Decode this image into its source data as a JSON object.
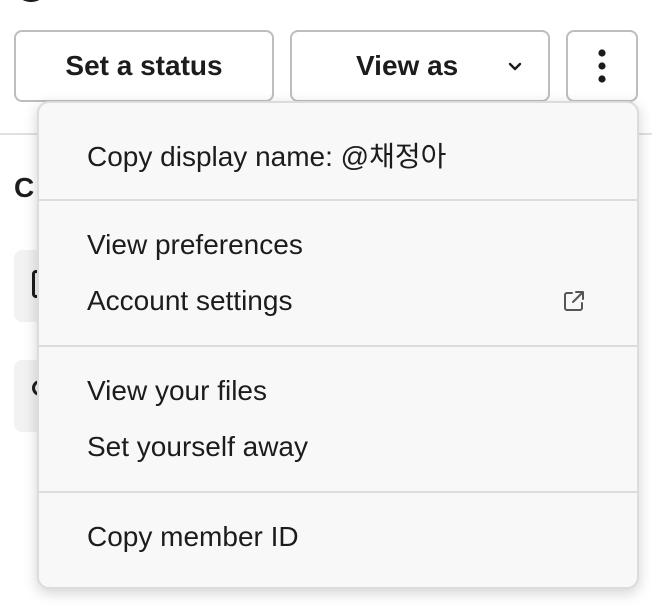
{
  "actions": {
    "set_status_label": "Set a status",
    "view_as_label": "View as",
    "more_icon": "vertical-ellipsis-icon",
    "view_as_icon": "chevron-down-icon"
  },
  "menu": {
    "copy_display_name": "Copy display name: @채정아",
    "view_preferences": "View preferences",
    "account_settings": "Account settings",
    "account_settings_icon": "external-link-icon",
    "view_your_files": "View your files",
    "set_yourself_away": "Set yourself away",
    "copy_member_id": "Copy member ID"
  },
  "colors": {
    "text": "#1d1c1d",
    "menu_background": "#f8f8f8",
    "border": "#bdbdbd"
  }
}
